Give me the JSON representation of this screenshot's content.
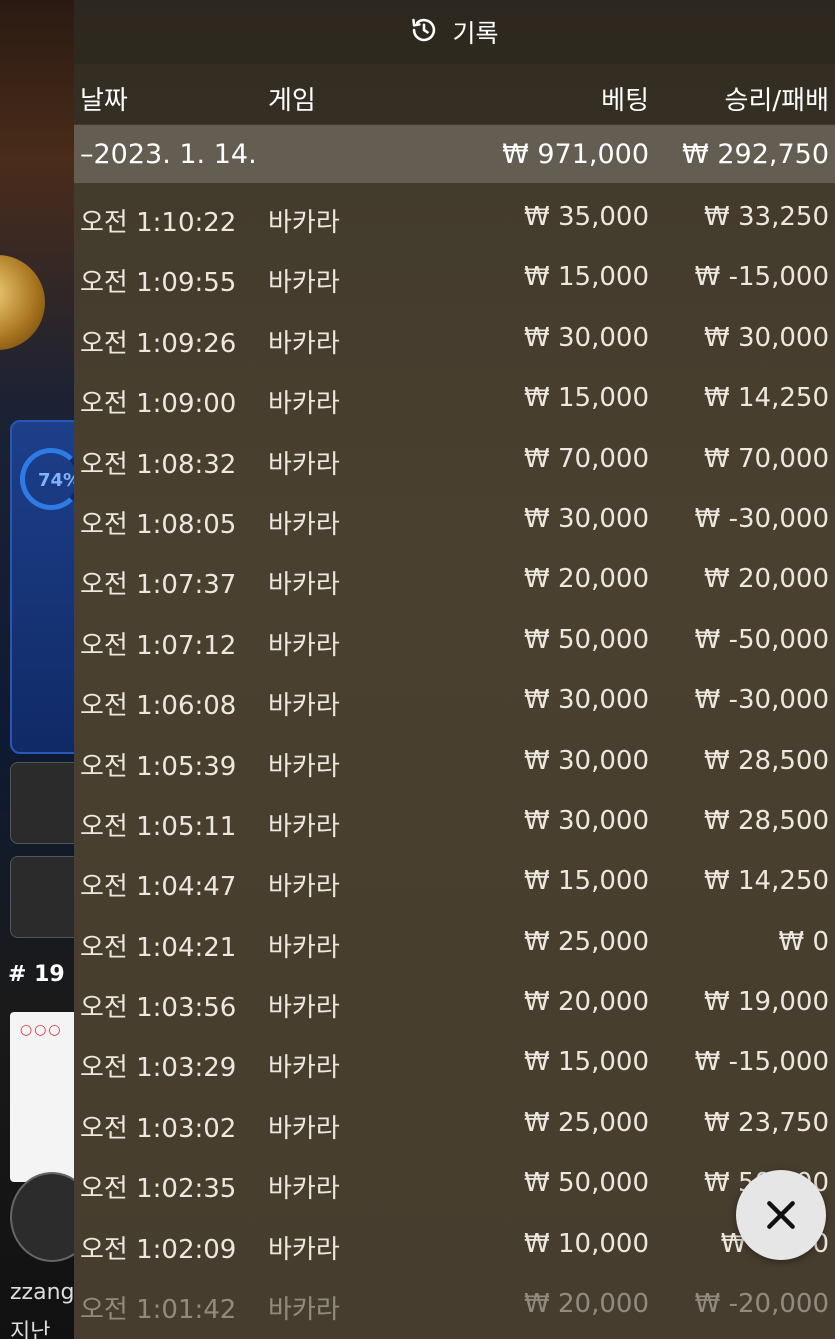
{
  "header": {
    "title": "기록",
    "icon": "history-icon"
  },
  "columns": {
    "date": "날짜",
    "game": "게임",
    "bet": "베팅",
    "winloss": "승리/패배"
  },
  "summary": {
    "date": "–2023. 1. 14.",
    "bet": "₩ 971,000",
    "winloss": "₩ 292,750"
  },
  "rows": [
    {
      "time": "오전 1:10:22",
      "game": "바카라",
      "bet": "₩ 35,000",
      "winloss": "₩ 33,250"
    },
    {
      "time": "오전 1:09:55",
      "game": "바카라",
      "bet": "₩ 15,000",
      "winloss": "₩ -15,000"
    },
    {
      "time": "오전 1:09:26",
      "game": "바카라",
      "bet": "₩ 30,000",
      "winloss": "₩ 30,000"
    },
    {
      "time": "오전 1:09:00",
      "game": "바카라",
      "bet": "₩ 15,000",
      "winloss": "₩ 14,250"
    },
    {
      "time": "오전 1:08:32",
      "game": "바카라",
      "bet": "₩ 70,000",
      "winloss": "₩ 70,000"
    },
    {
      "time": "오전 1:08:05",
      "game": "바카라",
      "bet": "₩ 30,000",
      "winloss": "₩ -30,000"
    },
    {
      "time": "오전 1:07:37",
      "game": "바카라",
      "bet": "₩ 20,000",
      "winloss": "₩ 20,000"
    },
    {
      "time": "오전 1:07:12",
      "game": "바카라",
      "bet": "₩ 50,000",
      "winloss": "₩ -50,000"
    },
    {
      "time": "오전 1:06:08",
      "game": "바카라",
      "bet": "₩ 30,000",
      "winloss": "₩ -30,000"
    },
    {
      "time": "오전 1:05:39",
      "game": "바카라",
      "bet": "₩ 30,000",
      "winloss": "₩ 28,500"
    },
    {
      "time": "오전 1:05:11",
      "game": "바카라",
      "bet": "₩ 30,000",
      "winloss": "₩ 28,500"
    },
    {
      "time": "오전 1:04:47",
      "game": "바카라",
      "bet": "₩ 15,000",
      "winloss": "₩ 14,250"
    },
    {
      "time": "오전 1:04:21",
      "game": "바카라",
      "bet": "₩ 25,000",
      "winloss": "₩ 0"
    },
    {
      "time": "오전 1:03:56",
      "game": "바카라",
      "bet": "₩ 20,000",
      "winloss": "₩ 19,000"
    },
    {
      "time": "오전 1:03:29",
      "game": "바카라",
      "bet": "₩ 15,000",
      "winloss": "₩ -15,000"
    },
    {
      "time": "오전 1:03:02",
      "game": "바카라",
      "bet": "₩ 25,000",
      "winloss": "₩ 23,750"
    },
    {
      "time": "오전 1:02:35",
      "game": "바카라",
      "bet": "₩ 50,000",
      "winloss": "₩ 50,000"
    },
    {
      "time": "오전 1:02:09",
      "game": "바카라",
      "bet": "₩ 10,000",
      "winloss": "₩ 9,500"
    },
    {
      "time": "오전 1:01:42",
      "game": "바카라",
      "bet": "₩ 20,000",
      "winloss": "₩ -20,000"
    }
  ],
  "background": {
    "progress_percent": "74%",
    "round_label": "# 19",
    "username": "zzang",
    "subtext": "지난 우"
  },
  "close_icon": "close-icon"
}
